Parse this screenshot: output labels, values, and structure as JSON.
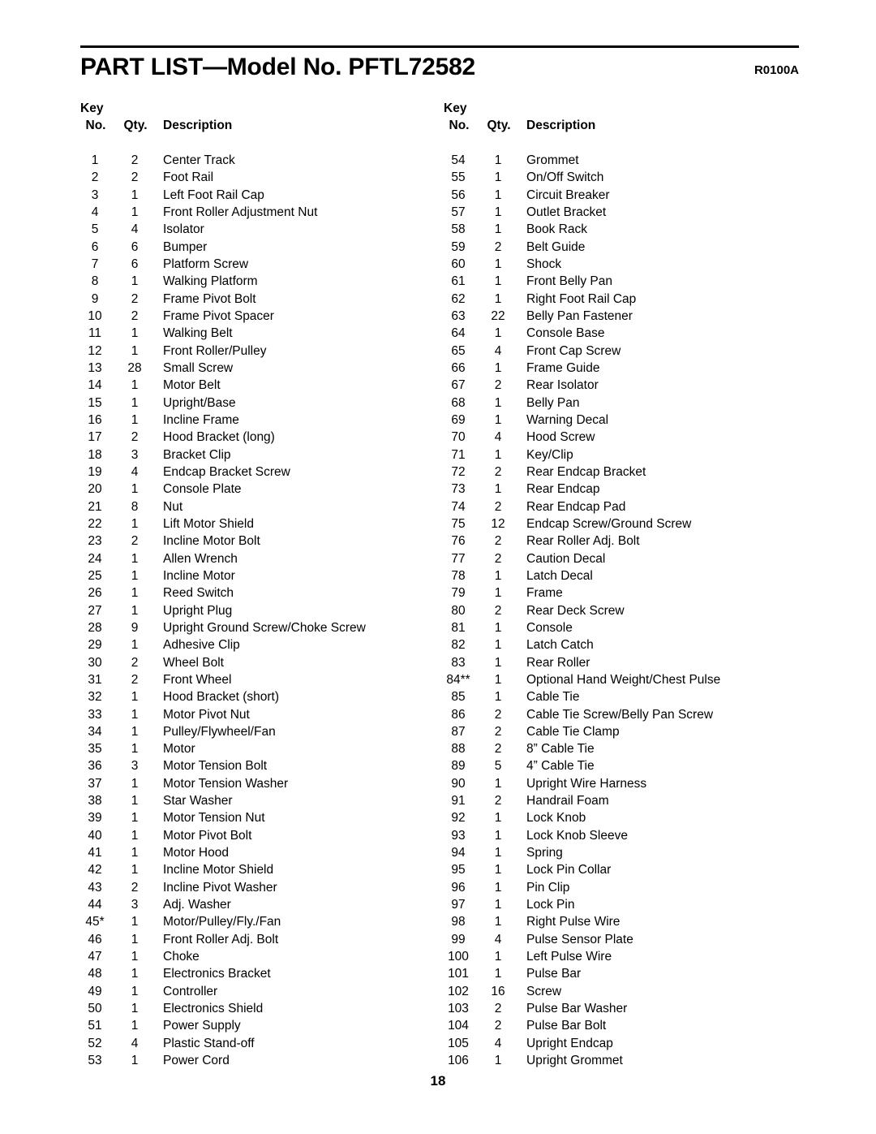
{
  "document": {
    "title": "PART LIST—Model No. PFTL72582",
    "revision_code": "R0100A",
    "page_number": "18"
  },
  "columns": {
    "headers": {
      "key_line1": "Key",
      "key_no": "No.",
      "qty": "Qty.",
      "description": "Description"
    },
    "left": {
      "rows": [
        {
          "no": "1",
          "qty": "2",
          "desc": "Center Track"
        },
        {
          "no": "2",
          "qty": "2",
          "desc": "Foot Rail"
        },
        {
          "no": "3",
          "qty": "1",
          "desc": "Left Foot Rail Cap"
        },
        {
          "no": "4",
          "qty": "1",
          "desc": "Front Roller Adjustment Nut"
        },
        {
          "no": "5",
          "qty": "4",
          "desc": "Isolator"
        },
        {
          "no": "6",
          "qty": "6",
          "desc": "Bumper"
        },
        {
          "no": "7",
          "qty": "6",
          "desc": "Platform Screw"
        },
        {
          "no": "8",
          "qty": "1",
          "desc": "Walking Platform"
        },
        {
          "no": "9",
          "qty": "2",
          "desc": "Frame Pivot Bolt"
        },
        {
          "no": "10",
          "qty": "2",
          "desc": "Frame Pivot Spacer"
        },
        {
          "no": "11",
          "qty": "1",
          "desc": "Walking Belt"
        },
        {
          "no": "12",
          "qty": "1",
          "desc": "Front Roller/Pulley"
        },
        {
          "no": "13",
          "qty": "28",
          "desc": "Small Screw"
        },
        {
          "no": "14",
          "qty": "1",
          "desc": "Motor Belt"
        },
        {
          "no": "15",
          "qty": "1",
          "desc": "Upright/Base"
        },
        {
          "no": "16",
          "qty": "1",
          "desc": "Incline Frame"
        },
        {
          "no": "17",
          "qty": "2",
          "desc": "Hood Bracket (long)"
        },
        {
          "no": "18",
          "qty": "3",
          "desc": "Bracket Clip"
        },
        {
          "no": "19",
          "qty": "4",
          "desc": "Endcap Bracket Screw"
        },
        {
          "no": "20",
          "qty": "1",
          "desc": "Console Plate"
        },
        {
          "no": "21",
          "qty": "8",
          "desc": "Nut"
        },
        {
          "no": "22",
          "qty": "1",
          "desc": "Lift Motor Shield"
        },
        {
          "no": "23",
          "qty": "2",
          "desc": "Incline Motor Bolt"
        },
        {
          "no": "24",
          "qty": "1",
          "desc": "Allen Wrench"
        },
        {
          "no": "25",
          "qty": "1",
          "desc": "Incline Motor"
        },
        {
          "no": "26",
          "qty": "1",
          "desc": "Reed Switch"
        },
        {
          "no": "27",
          "qty": "1",
          "desc": "Upright Plug"
        },
        {
          "no": "28",
          "qty": "9",
          "desc": "Upright Ground Screw/Choke Screw"
        },
        {
          "no": "29",
          "qty": "1",
          "desc": "Adhesive Clip"
        },
        {
          "no": "30",
          "qty": "2",
          "desc": "Wheel Bolt"
        },
        {
          "no": "31",
          "qty": "2",
          "desc": "Front Wheel"
        },
        {
          "no": "32",
          "qty": "1",
          "desc": "Hood Bracket (short)"
        },
        {
          "no": "33",
          "qty": "1",
          "desc": "Motor Pivot Nut"
        },
        {
          "no": "34",
          "qty": "1",
          "desc": "Pulley/Flywheel/Fan"
        },
        {
          "no": "35",
          "qty": "1",
          "desc": "Motor"
        },
        {
          "no": "36",
          "qty": "3",
          "desc": "Motor Tension Bolt"
        },
        {
          "no": "37",
          "qty": "1",
          "desc": "Motor Tension Washer"
        },
        {
          "no": "38",
          "qty": "1",
          "desc": "Star Washer"
        },
        {
          "no": "39",
          "qty": "1",
          "desc": "Motor Tension Nut"
        },
        {
          "no": "40",
          "qty": "1",
          "desc": "Motor Pivot Bolt"
        },
        {
          "no": "41",
          "qty": "1",
          "desc": "Motor Hood"
        },
        {
          "no": "42",
          "qty": "1",
          "desc": "Incline Motor Shield"
        },
        {
          "no": "43",
          "qty": "2",
          "desc": "Incline Pivot Washer"
        },
        {
          "no": "44",
          "qty": "3",
          "desc": "Adj. Washer"
        },
        {
          "no": "45*",
          "qty": "1",
          "desc": "Motor/Pulley/Fly./Fan"
        },
        {
          "no": "46",
          "qty": "1",
          "desc": "Front Roller Adj. Bolt"
        },
        {
          "no": "47",
          "qty": "1",
          "desc": "Choke"
        },
        {
          "no": "48",
          "qty": "1",
          "desc": "Electronics Bracket"
        },
        {
          "no": "49",
          "qty": "1",
          "desc": "Controller"
        },
        {
          "no": "50",
          "qty": "1",
          "desc": "Electronics Shield"
        },
        {
          "no": "51",
          "qty": "1",
          "desc": "Power Supply"
        },
        {
          "no": "52",
          "qty": "4",
          "desc": "Plastic Stand-off"
        },
        {
          "no": "53",
          "qty": "1",
          "desc": "Power Cord"
        }
      ]
    },
    "right": {
      "rows": [
        {
          "no": "54",
          "qty": "1",
          "desc": "Grommet"
        },
        {
          "no": "55",
          "qty": "1",
          "desc": "On/Off Switch"
        },
        {
          "no": "56",
          "qty": "1",
          "desc": "Circuit Breaker"
        },
        {
          "no": "57",
          "qty": "1",
          "desc": "Outlet Bracket"
        },
        {
          "no": "58",
          "qty": "1",
          "desc": "Book Rack"
        },
        {
          "no": "59",
          "qty": "2",
          "desc": "Belt Guide"
        },
        {
          "no": "60",
          "qty": "1",
          "desc": "Shock"
        },
        {
          "no": "61",
          "qty": "1",
          "desc": "Front Belly Pan"
        },
        {
          "no": "62",
          "qty": "1",
          "desc": "Right Foot Rail Cap"
        },
        {
          "no": "63",
          "qty": "22",
          "desc": "Belly Pan Fastener"
        },
        {
          "no": "64",
          "qty": "1",
          "desc": "Console Base"
        },
        {
          "no": "65",
          "qty": "4",
          "desc": "Front Cap Screw"
        },
        {
          "no": "66",
          "qty": "1",
          "desc": "Frame Guide"
        },
        {
          "no": "67",
          "qty": "2",
          "desc": "Rear Isolator"
        },
        {
          "no": "68",
          "qty": "1",
          "desc": "Belly Pan"
        },
        {
          "no": "69",
          "qty": "1",
          "desc": "Warning Decal"
        },
        {
          "no": "70",
          "qty": "4",
          "desc": "Hood Screw"
        },
        {
          "no": "71",
          "qty": "1",
          "desc": "Key/Clip"
        },
        {
          "no": "72",
          "qty": "2",
          "desc": "Rear Endcap Bracket"
        },
        {
          "no": "73",
          "qty": "1",
          "desc": "Rear Endcap"
        },
        {
          "no": "74",
          "qty": "2",
          "desc": "Rear Endcap Pad"
        },
        {
          "no": "75",
          "qty": "12",
          "desc": "Endcap Screw/Ground Screw"
        },
        {
          "no": "76",
          "qty": "2",
          "desc": "Rear Roller Adj. Bolt"
        },
        {
          "no": "77",
          "qty": "2",
          "desc": "Caution Decal"
        },
        {
          "no": "78",
          "qty": "1",
          "desc": "Latch Decal"
        },
        {
          "no": "79",
          "qty": "1",
          "desc": "Frame"
        },
        {
          "no": "80",
          "qty": "2",
          "desc": "Rear Deck Screw"
        },
        {
          "no": "81",
          "qty": "1",
          "desc": "Console"
        },
        {
          "no": "82",
          "qty": "1",
          "desc": "Latch Catch"
        },
        {
          "no": "83",
          "qty": "1",
          "desc": "Rear Roller"
        },
        {
          "no": "84**",
          "qty": "1",
          "desc": "Optional Hand Weight/Chest Pulse"
        },
        {
          "no": "85",
          "qty": "1",
          "desc": "Cable Tie"
        },
        {
          "no": "86",
          "qty": "2",
          "desc": "Cable Tie Screw/Belly Pan Screw"
        },
        {
          "no": "87",
          "qty": "2",
          "desc": "Cable Tie Clamp"
        },
        {
          "no": "88",
          "qty": "2",
          "desc": "8” Cable Tie"
        },
        {
          "no": "89",
          "qty": "5",
          "desc": "4” Cable Tie"
        },
        {
          "no": "90",
          "qty": "1",
          "desc": "Upright Wire Harness"
        },
        {
          "no": "91",
          "qty": "2",
          "desc": "Handrail Foam"
        },
        {
          "no": "92",
          "qty": "1",
          "desc": "Lock Knob"
        },
        {
          "no": "93",
          "qty": "1",
          "desc": "Lock Knob Sleeve"
        },
        {
          "no": "94",
          "qty": "1",
          "desc": "Spring"
        },
        {
          "no": "95",
          "qty": "1",
          "desc": "Lock Pin Collar"
        },
        {
          "no": "96",
          "qty": "1",
          "desc": "Pin Clip"
        },
        {
          "no": "97",
          "qty": "1",
          "desc": "Lock Pin"
        },
        {
          "no": "98",
          "qty": "1",
          "desc": "Right Pulse Wire"
        },
        {
          "no": "99",
          "qty": "4",
          "desc": "Pulse Sensor Plate"
        },
        {
          "no": "100",
          "qty": "1",
          "desc": "Left Pulse Wire"
        },
        {
          "no": "101",
          "qty": "1",
          "desc": "Pulse Bar"
        },
        {
          "no": "102",
          "qty": "16",
          "desc": "Screw"
        },
        {
          "no": "103",
          "qty": "2",
          "desc": "Pulse Bar Washer"
        },
        {
          "no": "104",
          "qty": "2",
          "desc": "Pulse Bar Bolt"
        },
        {
          "no": "105",
          "qty": "4",
          "desc": "Upright Endcap"
        },
        {
          "no": "106",
          "qty": "1",
          "desc": "Upright Grommet"
        }
      ]
    }
  }
}
